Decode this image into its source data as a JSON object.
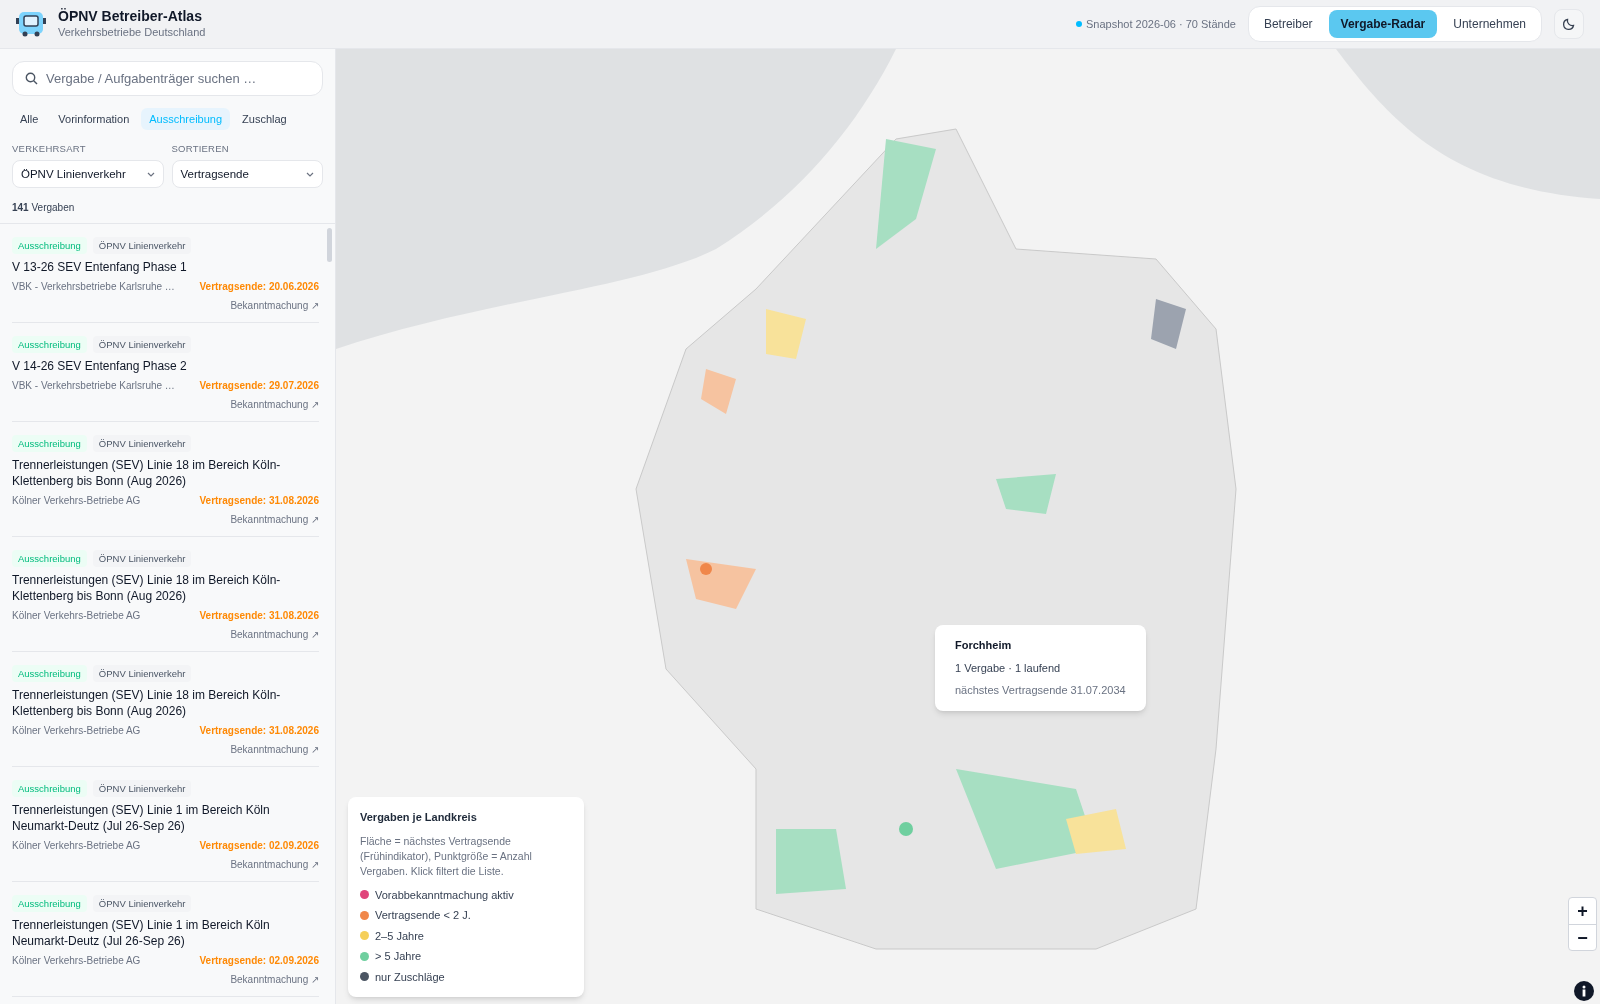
{
  "header": {
    "title": "ÖPNV Betreiber-Atlas",
    "subtitle": "Verkehrsbetriebe Deutschland",
    "snapshot": "Snapshot 2026-06 · 70 Stände",
    "views": [
      {
        "label": "Betreiber",
        "selected": false
      },
      {
        "label": "Vergabe-Radar",
        "selected": true
      },
      {
        "label": "Unternehmen",
        "selected": false
      }
    ]
  },
  "sidebar": {
    "search": {
      "placeholder": "Vergabe / Aufgabenträger suchen …"
    },
    "filters": [
      {
        "label": "Alle",
        "selected": false
      },
      {
        "label": "Vorinformation",
        "selected": false
      },
      {
        "label": "Ausschreibung",
        "selected": true
      },
      {
        "label": "Zuschlag",
        "selected": false
      }
    ],
    "selects": [
      {
        "label": "VERKEHRSART",
        "value": "ÖPNV Linienverkehr"
      },
      {
        "label": "SORTIEREN",
        "value": "Vertragsende"
      }
    ],
    "count": "141",
    "count_label": "Vergaben",
    "items": [
      {
        "status": "Ausschreibung",
        "type": "ÖPNV Linienverkehr",
        "title": "V 13-26 SEV Entenfang Phase 1",
        "org": "VBK - Verkehrsbetriebe Karlsruhe …",
        "end": "Vertragsende: 20.06.2026",
        "link": "Bekanntmachung ↗"
      },
      {
        "status": "Ausschreibung",
        "type": "ÖPNV Linienverkehr",
        "title": "V 14-26 SEV Entenfang Phase 2",
        "org": "VBK - Verkehrsbetriebe Karlsruhe …",
        "end": "Vertragsende: 29.07.2026",
        "link": "Bekanntmachung ↗"
      },
      {
        "status": "Ausschreibung",
        "type": "ÖPNV Linienverkehr",
        "title": "Trennerleistungen (SEV) Linie 18 im Bereich Köln-Klettenberg bis Bonn (Aug 2026)",
        "org": "Kölner Verkehrs-Betriebe AG",
        "end": "Vertragsende: 31.08.2026",
        "link": "Bekanntmachung ↗"
      },
      {
        "status": "Ausschreibung",
        "type": "ÖPNV Linienverkehr",
        "title": "Trennerleistungen (SEV) Linie 18 im Bereich Köln-Klettenberg bis Bonn (Aug 2026)",
        "org": "Kölner Verkehrs-Betriebe AG",
        "end": "Vertragsende: 31.08.2026",
        "link": "Bekanntmachung ↗"
      },
      {
        "status": "Ausschreibung",
        "type": "ÖPNV Linienverkehr",
        "title": "Trennerleistungen (SEV) Linie 18 im Bereich Köln-Klettenberg bis Bonn (Aug 2026)",
        "org": "Kölner Verkehrs-Betriebe AG",
        "end": "Vertragsende: 31.08.2026",
        "link": "Bekanntmachung ↗"
      },
      {
        "status": "Ausschreibung",
        "type": "ÖPNV Linienverkehr",
        "title": "Trennerleistungen (SEV) Linie 1 im Bereich Köln Neumarkt-Deutz (Jul 26-Sep 26)",
        "org": "Kölner Verkehrs-Betriebe AG",
        "end": "Vertragsende: 02.09.2026",
        "link": "Bekanntmachung ↗"
      },
      {
        "status": "Ausschreibung",
        "type": "ÖPNV Linienverkehr",
        "title": "Trennerleistungen (SEV) Linie 1 im Bereich Köln Neumarkt-Deutz (Jul 26-Sep 26)",
        "org": "Kölner Verkehrs-Betriebe AG",
        "end": "Vertragsende: 02.09.2026",
        "link": "Bekanntmachung ↗"
      }
    ]
  },
  "map": {
    "tooltip": {
      "title": "Forchheim",
      "line": "1 Vergabe · 1 laufend",
      "next": "nächstes Vertragsende 31.07.2034"
    },
    "legend": {
      "title": "Vergaben je Landkreis",
      "text": "Fläche = nächstes Vertragsende (Frühindikator), Punktgröße = Anzahl Vergaben. Klick filtert die Liste.",
      "entries": [
        {
          "label": "Vorabbekanntmachung aktiv",
          "color": "#e0457b"
        },
        {
          "label": "Vertragsende < 2 J.",
          "color": "#f0874a"
        },
        {
          "label": "2–5 Jahre",
          "color": "#f5cf5a"
        },
        {
          "label": "> 5 Jahre",
          "color": "#6fcf9f"
        },
        {
          "label": "nur Zuschläge",
          "color": "#4b5563"
        }
      ]
    },
    "zoom": [
      "+",
      "−"
    ]
  }
}
